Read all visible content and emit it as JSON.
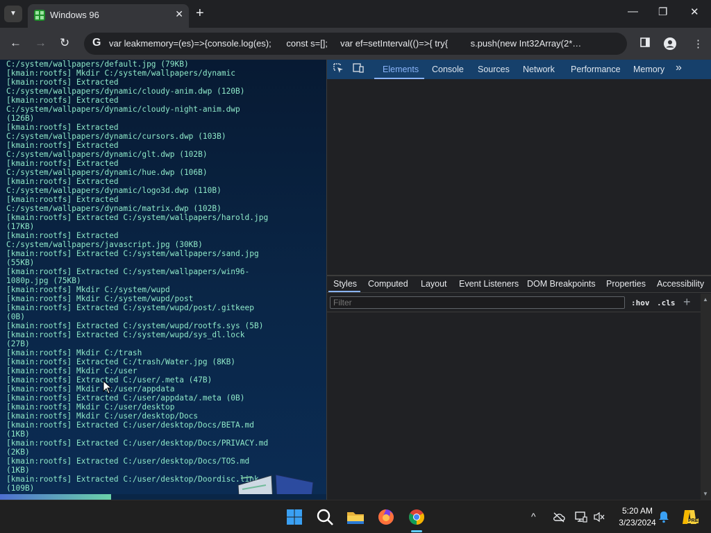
{
  "browser": {
    "tab_title": "Windows 96",
    "tab_close": "✕",
    "new_tab": "+",
    "window_controls": {
      "minimize": "—",
      "restore": "❐",
      "close": "✕"
    },
    "toolbar": {
      "back": "←",
      "forward": "→",
      "reload": "↻",
      "address_text": "var leakmemory=(es)=>{console.log(es);      const s=[];     var ef=setInterval(()=>{ try{         s.push(new Int32Array(2*…",
      "site_icon": "G"
    }
  },
  "terminal": {
    "lines": [
      "C:/system/wallpapers/default.jpg (79KB)",
      "[kmain:rootfs] Mkdir C:/system/wallpapers/dynamic",
      "[kmain:rootfs] Extracted",
      "C:/system/wallpapers/dynamic/cloudy-anim.dwp (120B)",
      "[kmain:rootfs] Extracted",
      "C:/system/wallpapers/dynamic/cloudy-night-anim.dwp",
      "(126B)",
      "[kmain:rootfs] Extracted",
      "C:/system/wallpapers/dynamic/cursors.dwp (103B)",
      "[kmain:rootfs] Extracted",
      "C:/system/wallpapers/dynamic/glt.dwp (102B)",
      "[kmain:rootfs] Extracted",
      "C:/system/wallpapers/dynamic/hue.dwp (106B)",
      "[kmain:rootfs] Extracted",
      "C:/system/wallpapers/dynamic/logo3d.dwp (110B)",
      "[kmain:rootfs] Extracted",
      "C:/system/wallpapers/dynamic/matrix.dwp (102B)",
      "[kmain:rootfs] Extracted C:/system/wallpapers/harold.jpg",
      "(17KB)",
      "[kmain:rootfs] Extracted",
      "C:/system/wallpapers/javascript.jpg (30KB)",
      "[kmain:rootfs] Extracted C:/system/wallpapers/sand.jpg",
      "(55KB)",
      "[kmain:rootfs] Extracted C:/system/wallpapers/win96-",
      "1080p.jpg (75KB)",
      "[kmain:rootfs] Mkdir C:/system/wupd",
      "[kmain:rootfs] Mkdir C:/system/wupd/post",
      "[kmain:rootfs] Extracted C:/system/wupd/post/.gitkeep",
      "(0B)",
      "[kmain:rootfs] Extracted C:/system/wupd/rootfs.sys (5B)",
      "[kmain:rootfs] Extracted C:/system/wupd/sys_dl.lock",
      "(27B)",
      "[kmain:rootfs] Mkdir C:/trash",
      "[kmain:rootfs] Extracted C:/trash/Water.jpg (8KB)",
      "[kmain:rootfs] Mkdir C:/user",
      "[kmain:rootfs] Extracted C:/user/.meta (47B)",
      "[kmain:rootfs] Mkdir C:/user/appdata",
      "[kmain:rootfs] Extracted C:/user/appdata/.meta (0B)",
      "[kmain:rootfs] Mkdir C:/user/desktop",
      "[kmain:rootfs] Mkdir C:/user/desktop/Docs",
      "[kmain:rootfs] Extracted C:/user/desktop/Docs/BETA.md",
      "(1KB)",
      "[kmain:rootfs] Extracted C:/user/desktop/Docs/PRIVACY.md",
      "(2KB)",
      "[kmain:rootfs] Extracted C:/user/desktop/Docs/TOS.md",
      "(1KB)",
      "[kmain:rootfs] Extracted C:/user/desktop/Doordisc.link",
      "(109B)"
    ],
    "progress": 0.34,
    "colors": {
      "text": "#8ee8c8",
      "background": "#0a2647"
    }
  },
  "devtools": {
    "tabs": [
      "Elements",
      "Console",
      "Sources",
      "Network",
      "Performance",
      "Memory"
    ],
    "more_tabs_icon": "»",
    "active_tab": "Elements",
    "subtabs": [
      "Styles",
      "Computed",
      "Layout",
      "Event Listeners",
      "DOM Breakpoints",
      "Properties",
      "Accessibility"
    ],
    "active_subtab": "Styles",
    "filter_placeholder": "Filter",
    "hov_label": ":hov",
    "cls_label": ".cls",
    "add_rule": "+",
    "accent": "#8ab4f8"
  },
  "taskbar": {
    "apps": [
      "start",
      "search",
      "file-explorer",
      "firefox",
      "chrome"
    ],
    "active_app": "chrome",
    "tray_chevron": "^",
    "clock_time": "5:20 AM",
    "clock_date": "3/23/2024",
    "copilot_badge": "PRE"
  }
}
